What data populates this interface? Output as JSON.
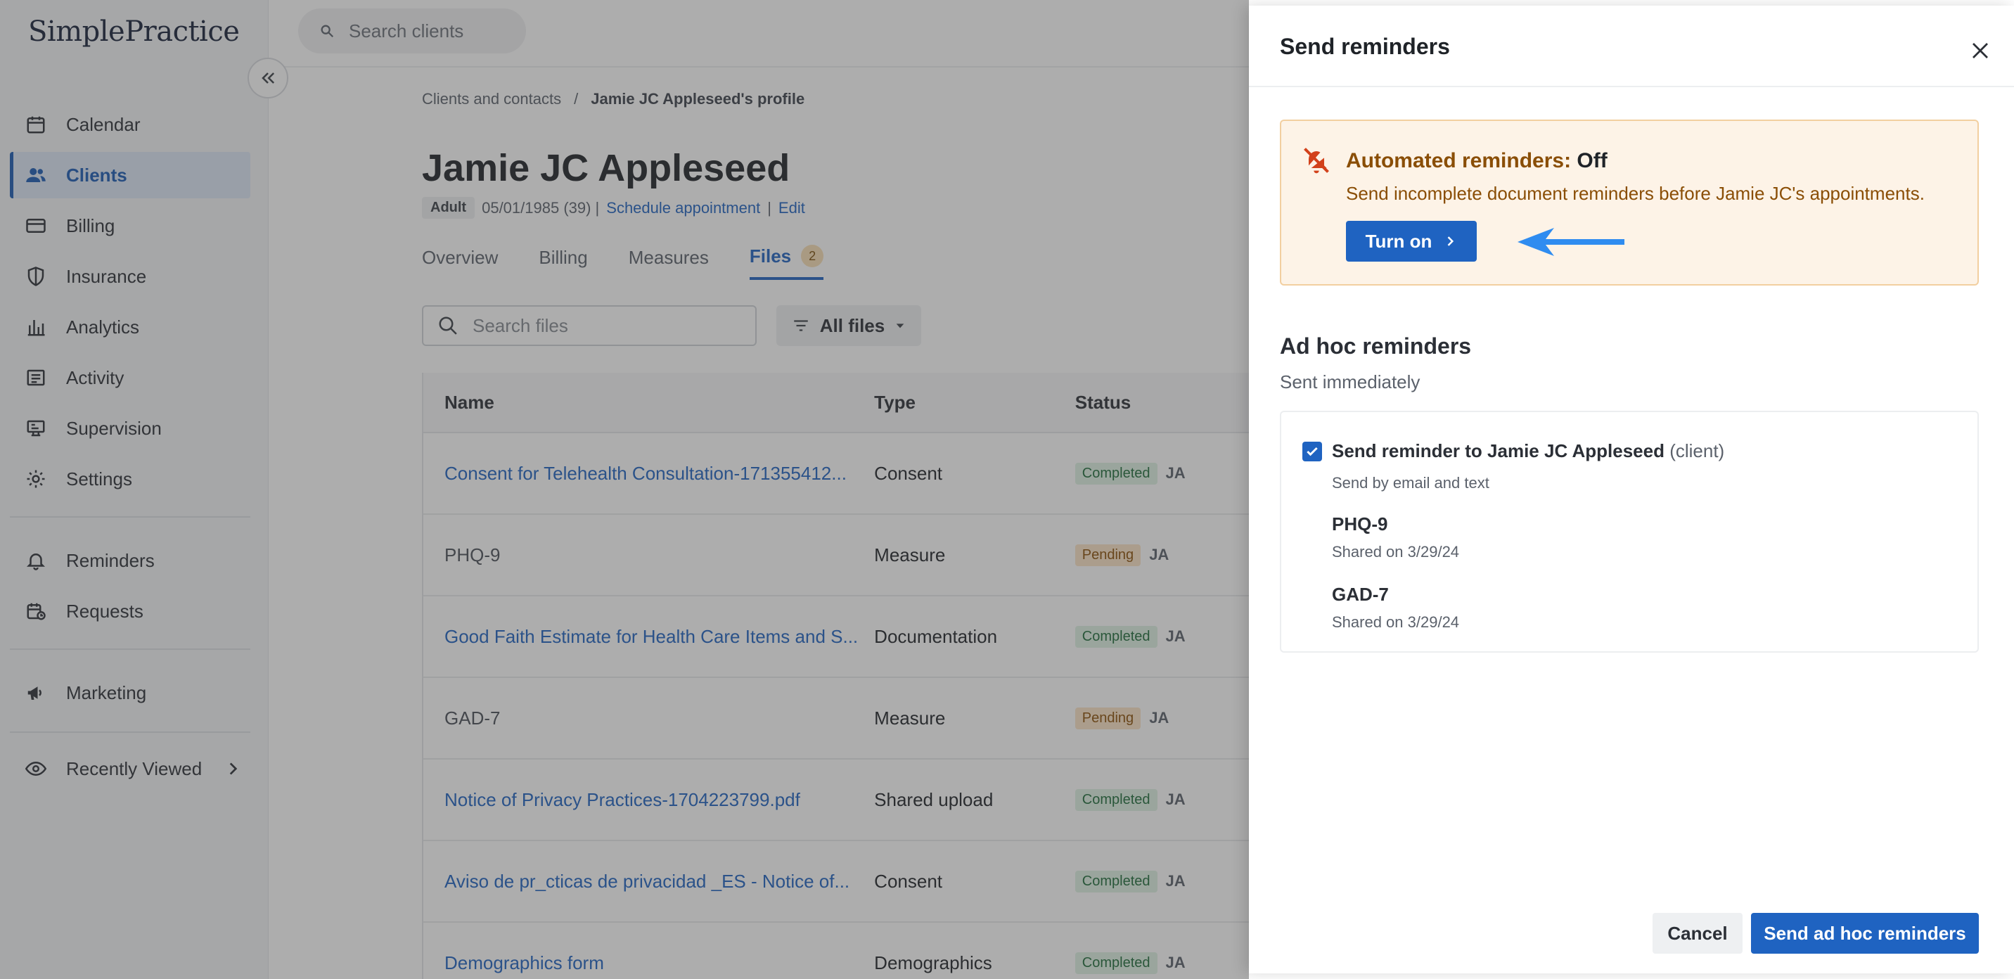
{
  "app": {
    "logo": "SimplePractice"
  },
  "sidebar": {
    "items": [
      {
        "label": "Calendar",
        "icon": "calendar-icon"
      },
      {
        "label": "Clients",
        "icon": "users-icon",
        "active": true
      },
      {
        "label": "Billing",
        "icon": "credit-card-icon"
      },
      {
        "label": "Insurance",
        "icon": "shield-icon"
      },
      {
        "label": "Analytics",
        "icon": "bar-chart-icon"
      },
      {
        "label": "Activity",
        "icon": "list-icon"
      },
      {
        "label": "Supervision",
        "icon": "supervision-icon"
      },
      {
        "label": "Settings",
        "icon": "gear-icon"
      },
      {
        "label": "Reminders",
        "icon": "bell-icon"
      },
      {
        "label": "Requests",
        "icon": "calendar-request-icon"
      },
      {
        "label": "Marketing",
        "icon": "megaphone-icon"
      },
      {
        "label": "Recently Viewed",
        "icon": "eye-icon"
      }
    ]
  },
  "search": {
    "placeholder": "Search clients"
  },
  "breadcrumb": {
    "parent": "Clients and contacts",
    "separator": "/",
    "current": "Jamie JC Appleseed's profile"
  },
  "client": {
    "name": "Jamie JC Appleseed",
    "badge": "Adult",
    "dob": "05/01/1985 (39) |",
    "schedule_link": "Schedule appointment",
    "pipe": "|",
    "edit_link": "Edit"
  },
  "tabs": [
    {
      "label": "Overview"
    },
    {
      "label": "Billing"
    },
    {
      "label": "Measures"
    },
    {
      "label": "Files",
      "count": "2",
      "active": true
    }
  ],
  "files": {
    "search_placeholder": "Search files",
    "filter_label": "All files",
    "columns": [
      "Name",
      "Type",
      "Status"
    ],
    "rows": [
      {
        "name": "Consent for Telehealth Consultation-171355412...",
        "link": true,
        "type": "Consent",
        "status": "Completed",
        "by": "JA"
      },
      {
        "name": "PHQ-9",
        "link": false,
        "type": "Measure",
        "status": "Pending",
        "by": "JA"
      },
      {
        "name": "Good Faith Estimate for Health Care Items and S...",
        "link": true,
        "type": "Documentation",
        "status": "Completed",
        "by": "JA"
      },
      {
        "name": "GAD-7",
        "link": false,
        "type": "Measure",
        "status": "Pending",
        "by": "JA"
      },
      {
        "name": "Notice of Privacy Practices-1704223799.pdf",
        "link": true,
        "type": "Shared upload",
        "status": "Completed",
        "by": "JA"
      },
      {
        "name": "Aviso de pr_cticas de privacidad _ES - Notice of...",
        "link": true,
        "type": "Consent",
        "status": "Completed",
        "by": "JA"
      },
      {
        "name": "Demographics form",
        "link": true,
        "type": "Demographics",
        "status": "Completed",
        "by": "JA"
      }
    ]
  },
  "modal": {
    "title": "Send reminders",
    "alert": {
      "title_prefix": "Automated reminders:",
      "title_state": "Off",
      "text": "Send incomplete document reminders before Jamie JC's appointments.",
      "button": "Turn on"
    },
    "adhoc": {
      "heading": "Ad hoc reminders",
      "sub": "Sent immediately",
      "recipient": "Send reminder to Jamie JC Appleseed",
      "recipient_tag": "(client)",
      "method": "Send by email and text",
      "docs": [
        {
          "name": "PHQ-9",
          "shared": "Shared on 3/29/24"
        },
        {
          "name": "GAD-7",
          "shared": "Shared on 3/29/24"
        }
      ]
    },
    "cancel": "Cancel",
    "send": "Send ad hoc reminders"
  },
  "colors": {
    "primary": "#1f63c1",
    "alert_bg": "#fdf3e7",
    "alert_text": "#8a4e06",
    "annotation_arrow": "#2f8cf0"
  }
}
